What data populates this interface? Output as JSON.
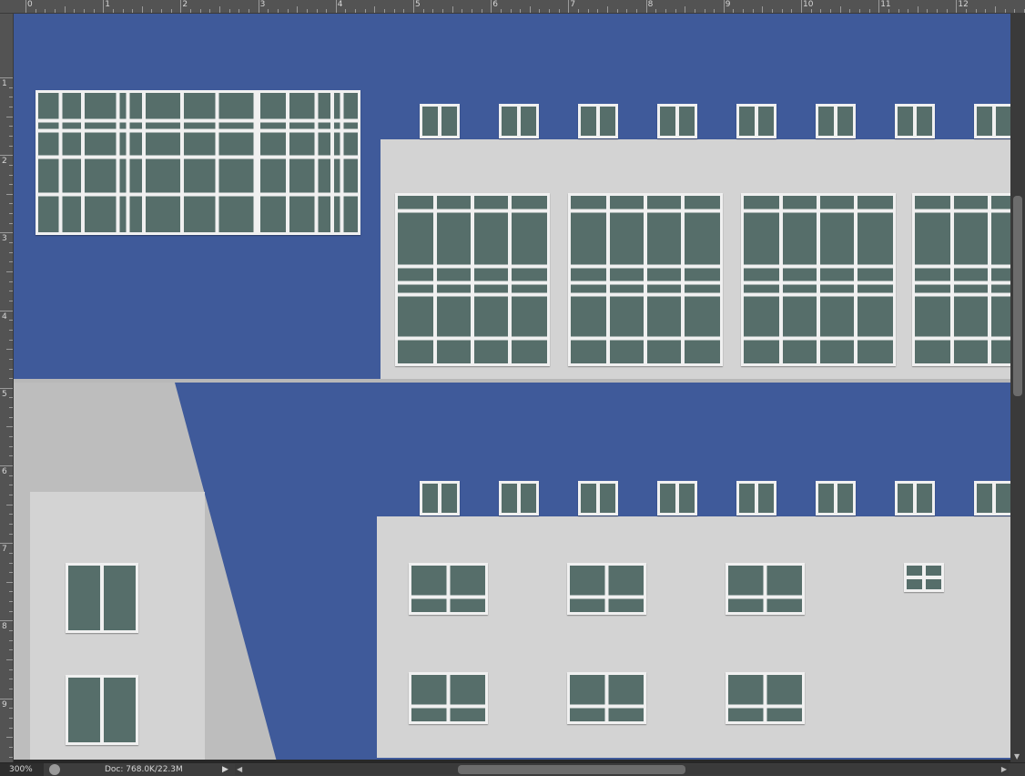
{
  "ruler": {
    "top_labels": [
      "0",
      "1",
      "2",
      "3",
      "4",
      "5",
      "6",
      "7",
      "8",
      "9",
      "10",
      "11",
      "12"
    ],
    "left_labels": [
      "1",
      "2",
      "3",
      "4",
      "5",
      "6",
      "7",
      "8",
      "9"
    ]
  },
  "status_bar": {
    "zoom": "300%",
    "doc_info": "Doc: 768.0K/22.3M",
    "arrow_icon": "play-arrow-icon"
  },
  "colors": {
    "sky": "#3f5a9a",
    "facade": "#d3d3d3",
    "glass": "#566e6a",
    "mullion": "#f0f0f0"
  }
}
